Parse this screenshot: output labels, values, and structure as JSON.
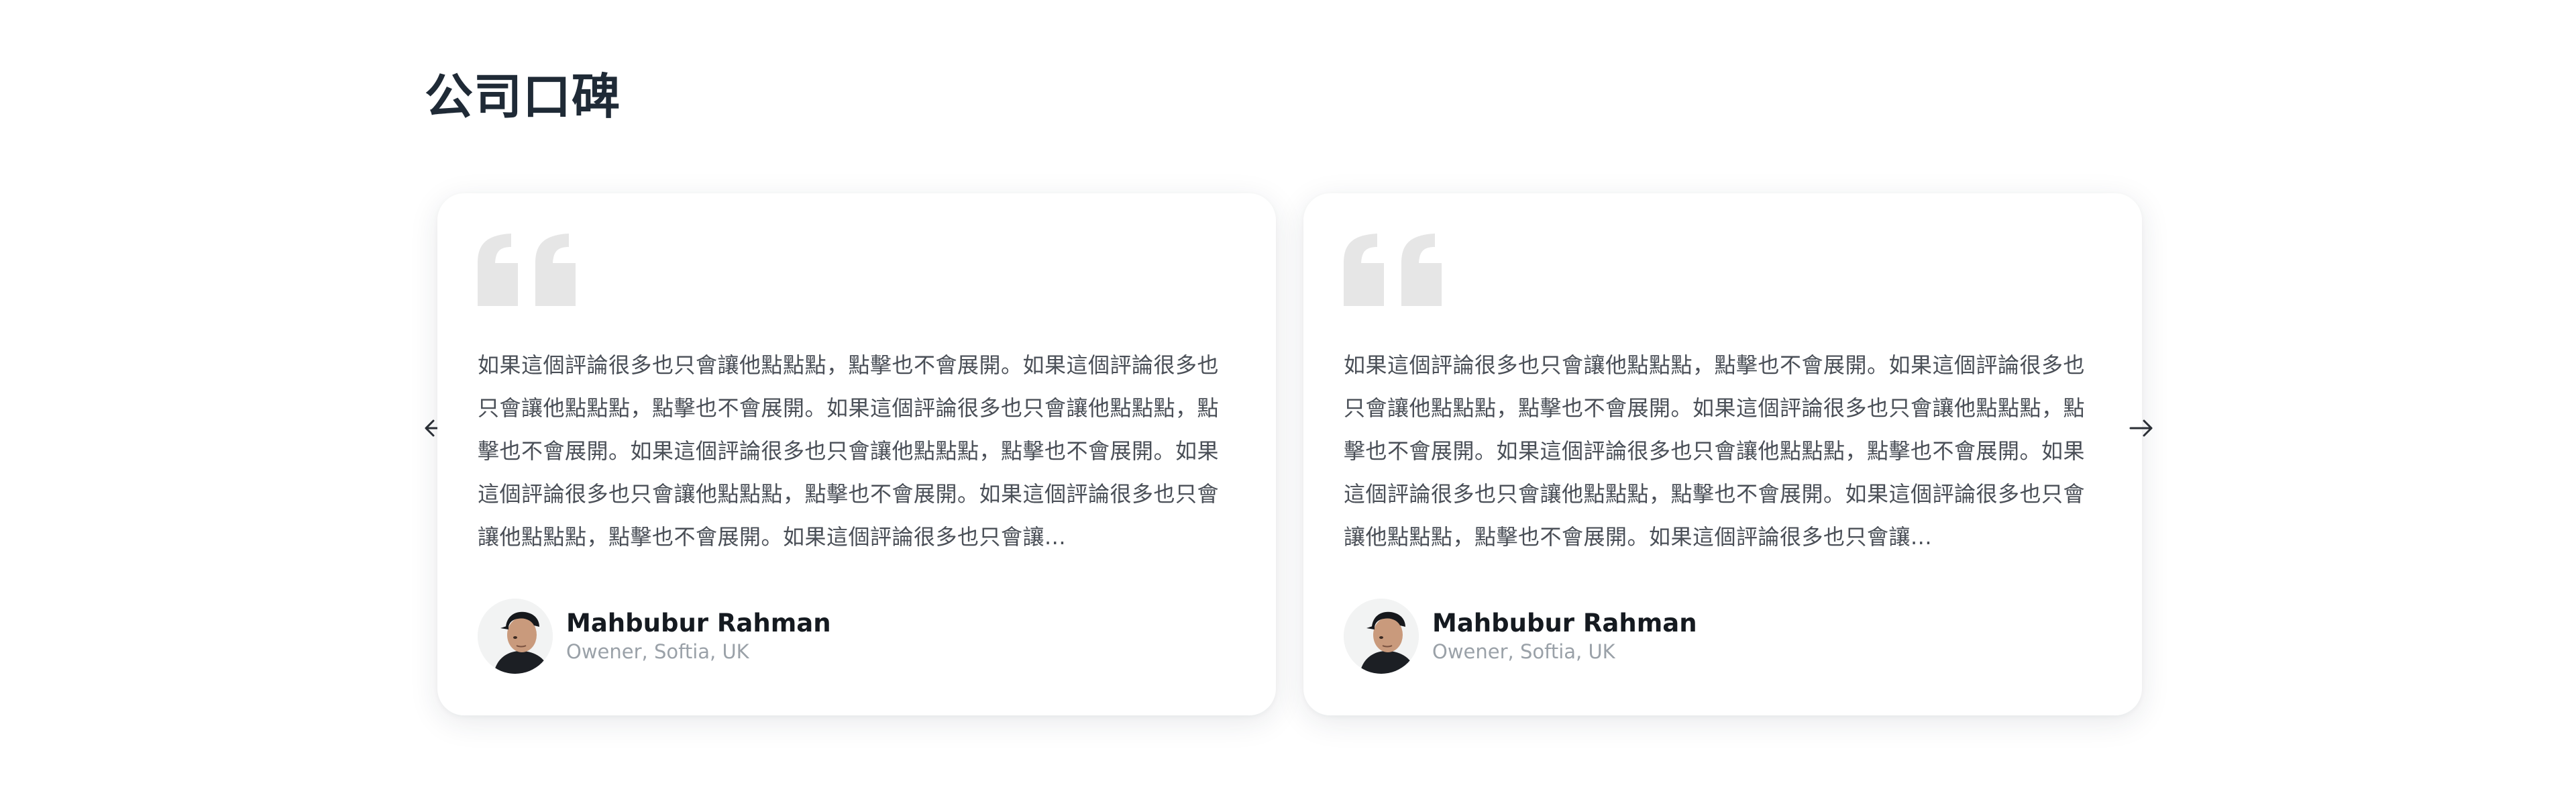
{
  "section": {
    "title": "公司口碑"
  },
  "navigation": {
    "prev_icon": "arrow-left-icon",
    "next_icon": "arrow-right-icon"
  },
  "colors": {
    "title": "#1f2a36",
    "quote_mark": "#e6e6e6",
    "body_text": "#4a4f57",
    "name": "#151a20",
    "role": "#9aa1a8"
  },
  "testimonials": [
    {
      "quote_icon": "quote-icon",
      "text": "如果這個評論很多也只會讓他點點點，點擊也不會展開。如果這個評論很多也只會讓他點點點，點擊也不會展開。如果這個評論很多也只會讓他點點點，點擊也不會展開。如果這個評論很多也只會讓他點點點，點擊也不會展開。如果這個評論很多也只會讓他點點點，點擊也不會展開。如果這個評論很多也只會讓他點點點，點擊也不會展開。如果這個評論很多也只會讓...",
      "author": {
        "name": "Mahbubur Rahman",
        "role": "Owener, Softia, UK",
        "avatar_icon": "avatar-photo"
      }
    },
    {
      "quote_icon": "quote-icon",
      "text": "如果這個評論很多也只會讓他點點點，點擊也不會展開。如果這個評論很多也只會讓他點點點，點擊也不會展開。如果這個評論很多也只會讓他點點點，點擊也不會展開。如果這個評論很多也只會讓他點點點，點擊也不會展開。如果這個評論很多也只會讓他點點點，點擊也不會展開。如果這個評論很多也只會讓他點點點，點擊也不會展開。如果這個評論很多也只會讓...",
      "author": {
        "name": "Mahbubur Rahman",
        "role": "Owener, Softia, UK",
        "avatar_icon": "avatar-photo"
      }
    }
  ]
}
